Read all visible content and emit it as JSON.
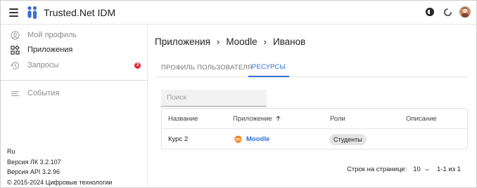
{
  "app": {
    "title": "Trusted.Net IDM"
  },
  "colors": {
    "accent": "#2f6fd3",
    "badge": "#e0283a",
    "logo": "#3b6fd6"
  },
  "topbar": {
    "icons": [
      "menu-icon",
      "logo-icon",
      "theme-toggle-icon",
      "refresh-icon",
      "avatar"
    ]
  },
  "sidebar": {
    "items": [
      {
        "label": "Мой профиль",
        "icon": "account-circle-icon",
        "active": false
      },
      {
        "label": "Приложения",
        "icon": "apps-grid-icon",
        "active": true
      },
      {
        "label": "Запросы",
        "icon": "history-icon",
        "active": false,
        "badge": "3"
      },
      {
        "label": "События",
        "icon": "event-list-icon",
        "active": false
      }
    ],
    "footer": {
      "lang": "Ru",
      "version_lk": "Версия ЛК 3.2.107",
      "version_api": "Версия API 3.2.96",
      "copyright": "© 2015-2024 Цифровые технологии"
    }
  },
  "breadcrumb": {
    "items": [
      "Приложения",
      "Moodle",
      "Иванов"
    ]
  },
  "tabs": [
    {
      "label": "Профиль пользователя",
      "active": false
    },
    {
      "label": "Ресурсы",
      "active": true
    }
  ],
  "search": {
    "placeholder": "Поиск",
    "value": ""
  },
  "table": {
    "columns": [
      "Название",
      "Приложение",
      "Роли",
      "Описание"
    ],
    "sort": {
      "column": "Приложение",
      "direction": "asc"
    },
    "rows": [
      {
        "name": "Курс 2",
        "app": "Moodle",
        "role": "Студенты",
        "description": ""
      }
    ]
  },
  "pagination": {
    "rows_per_page_label": "Строк на странице:",
    "rows_per_page": "10",
    "range": "1-1 из 1"
  }
}
